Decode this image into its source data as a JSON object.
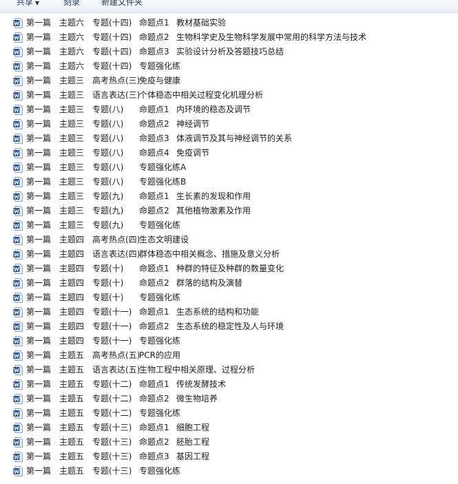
{
  "toolbar": {
    "share_label": "共享",
    "burn_label": "刻录",
    "new_folder_label": "新建文件夹"
  },
  "files": [
    {
      "icon": "word-doc-icon",
      "c1": "第一篇",
      "c2": "主题六",
      "c3": "专题(十四)",
      "c4": "命题点1",
      "c5": "教材基础实验"
    },
    {
      "icon": "word-doc-icon",
      "c1": "第一篇",
      "c2": "主题六",
      "c3": "专题(十四)",
      "c4": "命题点2",
      "c5": "生物科学史及生物科学发展中常用的科学方法与技术"
    },
    {
      "icon": "word-doc-icon",
      "c1": "第一篇",
      "c2": "主题六",
      "c3": "专题(十四)",
      "c4": "命题点3",
      "c5": "实验设计分析及答题技巧总结"
    },
    {
      "icon": "word-doc-icon",
      "c1": "第一篇",
      "c2": "主题六",
      "c3": "专题(十四)",
      "c4": "专题强化练",
      "c5": ""
    },
    {
      "icon": "word-doc-icon",
      "c1": "第一篇",
      "c2": "主题三",
      "c3": "高考热点(三)",
      "c4": "免疫与健康",
      "c5": ""
    },
    {
      "icon": "word-doc-icon",
      "c1": "第一篇",
      "c2": "主题三",
      "c3": "语言表达(三)",
      "c4": "个体稳态中相关过程变化机理分析",
      "c5": ""
    },
    {
      "icon": "word-doc-icon",
      "c1": "第一篇",
      "c2": "主题三",
      "c3": "专题(八)",
      "c4": "命题点1",
      "c5": "内环境的稳态及调节"
    },
    {
      "icon": "word-doc-icon",
      "c1": "第一篇",
      "c2": "主题三",
      "c3": "专题(八)",
      "c4": "命题点2",
      "c5": "神经调节"
    },
    {
      "icon": "word-doc-icon",
      "c1": "第一篇",
      "c2": "主题三",
      "c3": "专题(八)",
      "c4": "命题点3",
      "c5": "体液调节及其与神经调节的关系"
    },
    {
      "icon": "word-doc-icon",
      "c1": "第一篇",
      "c2": "主题三",
      "c3": "专题(八)",
      "c4": "命题点4",
      "c5": "免疫调节"
    },
    {
      "icon": "word-doc-icon",
      "c1": "第一篇",
      "c2": "主题三",
      "c3": "专题(八)",
      "c4": "专题强化练A",
      "c5": ""
    },
    {
      "icon": "word-doc-icon",
      "c1": "第一篇",
      "c2": "主题三",
      "c3": "专题(八)",
      "c4": "专题强化练B",
      "c5": ""
    },
    {
      "icon": "word-doc-icon",
      "c1": "第一篇",
      "c2": "主题三",
      "c3": "专题(九)",
      "c4": "命题点1",
      "c5": "生长素的发现和作用"
    },
    {
      "icon": "word-doc-icon",
      "c1": "第一篇",
      "c2": "主题三",
      "c3": "专题(九)",
      "c4": "命题点2",
      "c5": "其他植物激素及作用"
    },
    {
      "icon": "word-doc-icon",
      "c1": "第一篇",
      "c2": "主题三",
      "c3": "专题(九)",
      "c4": "专题强化练",
      "c5": ""
    },
    {
      "icon": "word-doc-icon",
      "c1": "第一篇",
      "c2": "主题四",
      "c3": "高考热点(四)",
      "c4": "生态文明建设",
      "c5": ""
    },
    {
      "icon": "word-doc-icon",
      "c1": "第一篇",
      "c2": "主题四",
      "c3": "语言表达(四)",
      "c4": "群体稳态中相关概念、措施及意义分析",
      "c5": ""
    },
    {
      "icon": "word-doc-icon",
      "c1": "第一篇",
      "c2": "主题四",
      "c3": "专题(十)",
      "c4": "命题点1",
      "c5": "种群的特征及种群的数量变化"
    },
    {
      "icon": "word-doc-icon",
      "c1": "第一篇",
      "c2": "主题四",
      "c3": "专题(十)",
      "c4": "命题点2",
      "c5": "群落的结构及演替"
    },
    {
      "icon": "word-doc-icon",
      "c1": "第一篇",
      "c2": "主题四",
      "c3": "专题(十)",
      "c4": "专题强化练",
      "c5": ""
    },
    {
      "icon": "word-doc-icon",
      "c1": "第一篇",
      "c2": "主题四",
      "c3": "专题(十一)",
      "c4": "命题点1",
      "c5": "生态系统的结构和功能"
    },
    {
      "icon": "word-doc-icon",
      "c1": "第一篇",
      "c2": "主题四",
      "c3": "专题(十一)",
      "c4": "命题点2",
      "c5": "生态系统的稳定性及人与环境"
    },
    {
      "icon": "word-doc-icon",
      "c1": "第一篇",
      "c2": "主题四",
      "c3": "专题(十一)",
      "c4": "专题强化练",
      "c5": ""
    },
    {
      "icon": "word-doc-icon",
      "c1": "第一篇",
      "c2": "主题五",
      "c3": "高考热点(五)",
      "c4": "PCR的应用",
      "c5": ""
    },
    {
      "icon": "word-doc-icon",
      "c1": "第一篇",
      "c2": "主题五",
      "c3": "语言表达(五)",
      "c4": "生物工程中相关原理、过程分析",
      "c5": ""
    },
    {
      "icon": "word-doc-icon",
      "c1": "第一篇",
      "c2": "主题五",
      "c3": "专题(十二)",
      "c4": "命题点1",
      "c5": "传统发酵技术"
    },
    {
      "icon": "word-doc-icon",
      "c1": "第一篇",
      "c2": "主题五",
      "c3": "专题(十二)",
      "c4": "命题点2",
      "c5": "微生物培养"
    },
    {
      "icon": "word-doc-icon",
      "c1": "第一篇",
      "c2": "主题五",
      "c3": "专题(十二)",
      "c4": "专题强化练",
      "c5": ""
    },
    {
      "icon": "word-doc-icon",
      "c1": "第一篇",
      "c2": "主题五",
      "c3": "专题(十三)",
      "c4": "命题点1",
      "c5": "细胞工程"
    },
    {
      "icon": "word-doc-icon",
      "c1": "第一篇",
      "c2": "主题五",
      "c3": "专题(十三)",
      "c4": "命题点2",
      "c5": "胚胎工程"
    },
    {
      "icon": "word-doc-icon",
      "c1": "第一篇",
      "c2": "主题五",
      "c3": "专题(十三)",
      "c4": "命题点3",
      "c5": "基因工程"
    },
    {
      "icon": "word-doc-icon",
      "c1": "第一篇",
      "c2": "主题五",
      "c3": "专题(十三)",
      "c4": "专题强化练",
      "c5": ""
    }
  ],
  "colors": {
    "word_icon_blue": "#2b5797",
    "word_icon_light": "#e8eef8"
  }
}
